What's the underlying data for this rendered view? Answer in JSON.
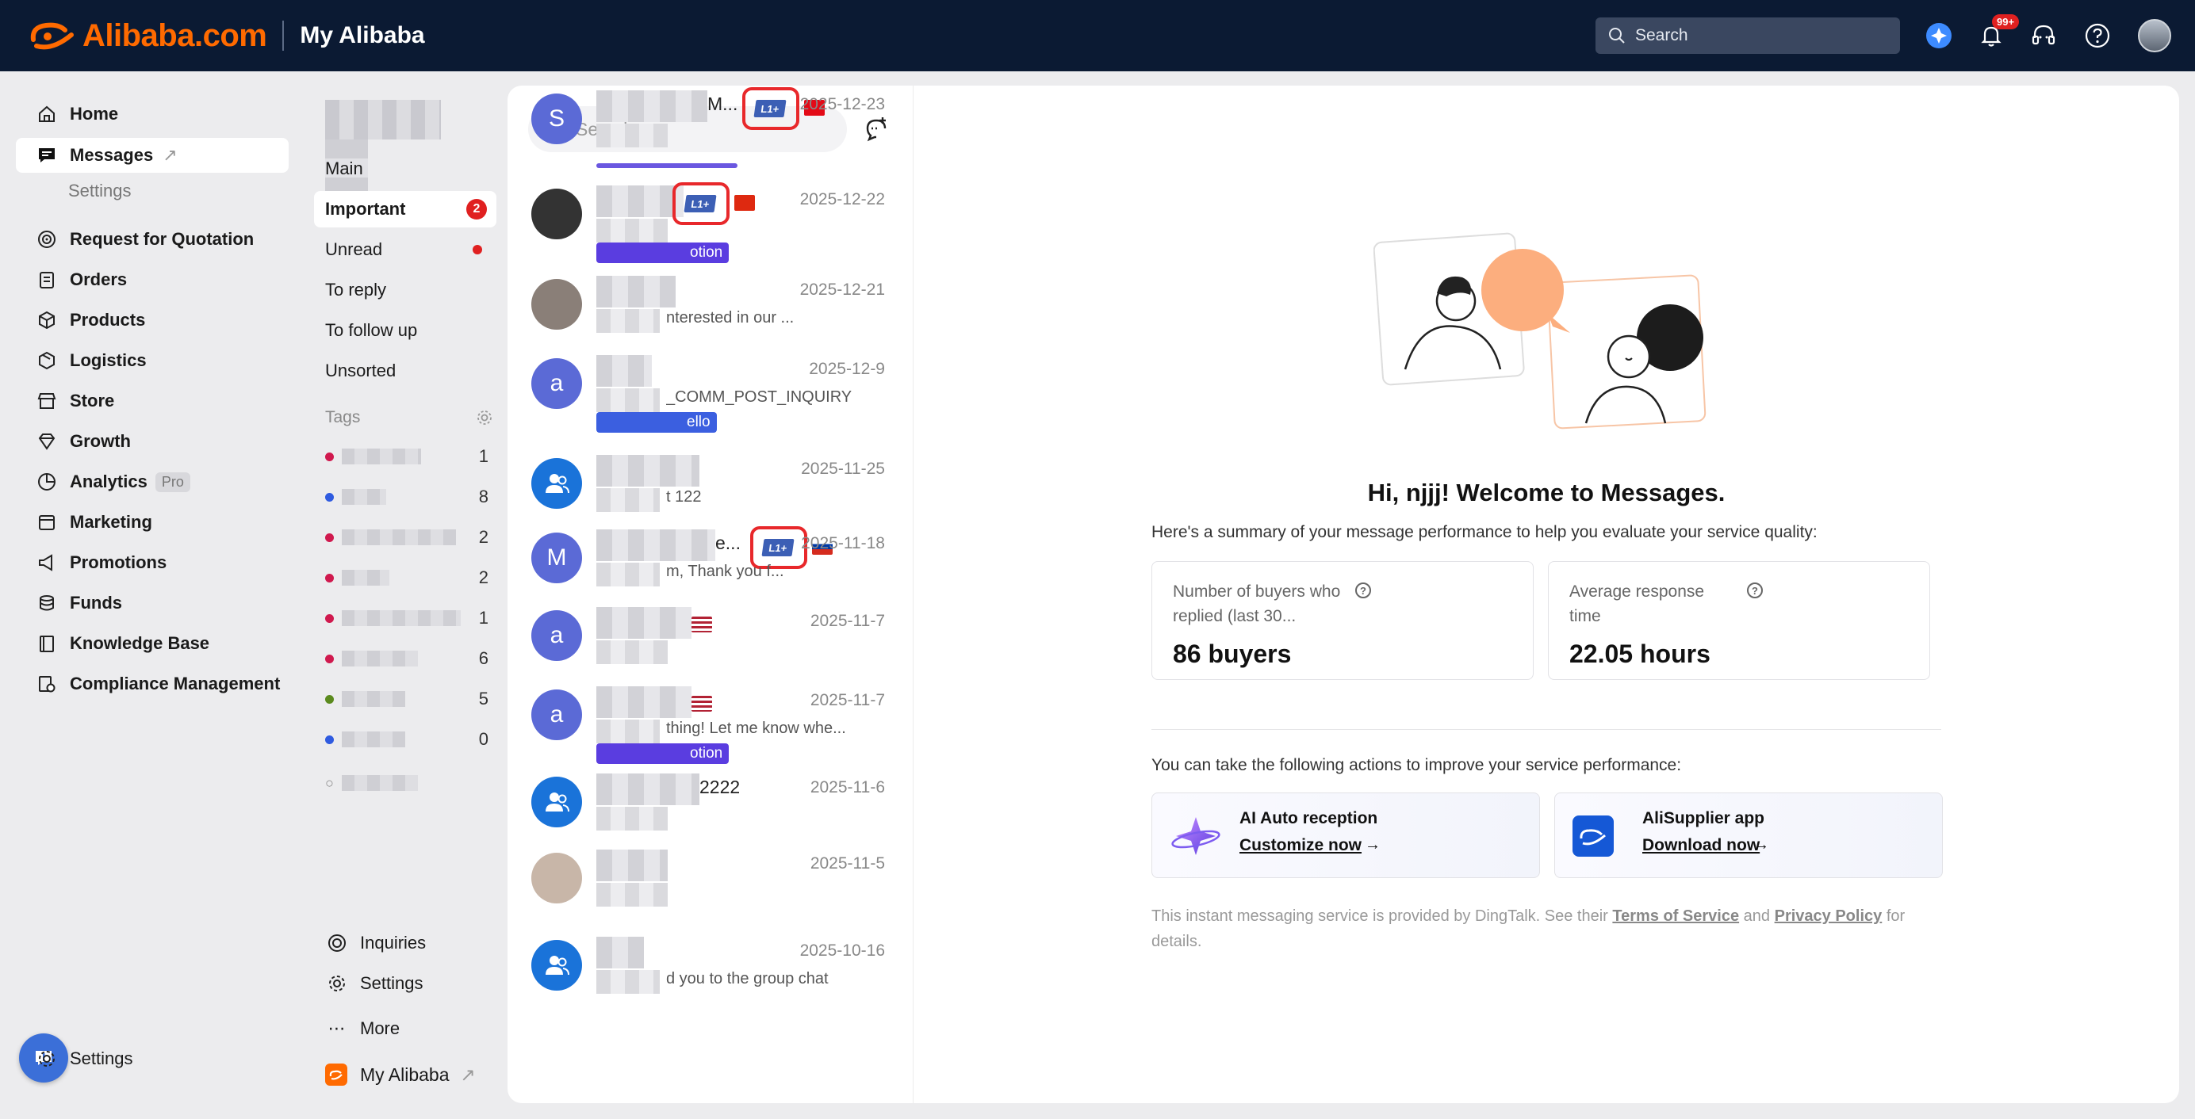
{
  "topbar": {
    "brand": "Alibaba.com",
    "section": "My Alibaba",
    "search_label": "Search",
    "notifications_badge": "99+"
  },
  "leftnav": {
    "items": [
      {
        "label": "Home",
        "icon": "home-icon"
      },
      {
        "label": "Messages",
        "icon": "message-icon"
      },
      {
        "label": "Request for Quotation",
        "icon": "target-icon"
      },
      {
        "label": "Orders",
        "icon": "clipboard-icon"
      },
      {
        "label": "Products",
        "icon": "box-icon"
      },
      {
        "label": "Logistics",
        "icon": "truck-icon"
      },
      {
        "label": "Store",
        "icon": "store-icon"
      },
      {
        "label": "Growth",
        "icon": "diamond-icon"
      },
      {
        "label": "Analytics",
        "icon": "chart-icon"
      },
      {
        "label": "Marketing",
        "icon": "calendar-icon"
      },
      {
        "label": "Promotions",
        "icon": "megaphone-icon"
      },
      {
        "label": "Funds",
        "icon": "coins-icon"
      },
      {
        "label": "Knowledge Base",
        "icon": "book-icon"
      },
      {
        "label": "Compliance Management",
        "icon": "shield-doc-icon"
      }
    ],
    "messages_sub": "Settings",
    "analytics_badge": "Pro",
    "bottom_settings": "Settings"
  },
  "folders": {
    "items": [
      "Main",
      "Important",
      "Unread",
      "To reply",
      "To follow up",
      "Unsorted"
    ],
    "important_count": "2",
    "tags_label": "Tags",
    "tags": [
      {
        "color": "#d0194e",
        "count": "1"
      },
      {
        "color": "#2f5be0",
        "count": "8"
      },
      {
        "color": "#d0194e",
        "count": "2"
      },
      {
        "color": "#d0194e",
        "count": "2"
      },
      {
        "color": "#d0194e",
        "count": "1"
      },
      {
        "color": "#d0194e",
        "count": "6"
      },
      {
        "color": "#5b8a1e",
        "count": "5"
      },
      {
        "color": "#2f5be0",
        "count": "0"
      }
    ],
    "inquiries": "Inquiries",
    "settings": "Settings",
    "more": "More",
    "my_alibaba": "My Alibaba"
  },
  "conversations": {
    "search_placeholder": "Search",
    "items": [
      {
        "avatar": "S",
        "avatar_color": "#5b6ad6",
        "name_tail": "M...",
        "badge": "L1+",
        "flag": "tr",
        "date": "2025-12-23",
        "preview": "",
        "tag": ""
      },
      {
        "avatar": "",
        "avatar_color": "#333",
        "name_tail": "",
        "badge": "L1+",
        "flag": "hk",
        "date": "2025-12-22",
        "preview": "",
        "tag": "otion"
      },
      {
        "avatar": "",
        "avatar_color": "#8a7f78",
        "name_tail": "",
        "badge": "",
        "flag": "",
        "date": "2025-12-21",
        "preview": "nterested in our ...",
        "tag": ""
      },
      {
        "avatar": "a",
        "avatar_color": "#5b6ad6",
        "name_tail": "",
        "badge": "",
        "flag": "",
        "date": "2025-12-9",
        "preview": "_COMM_POST_INQUIRY",
        "tag": "ello"
      },
      {
        "avatar": "",
        "avatar_color": "#1a73d9",
        "name_tail": "",
        "badge": "",
        "flag": "",
        "date": "2025-11-25",
        "preview": "t 122",
        "tag": ""
      },
      {
        "avatar": "M",
        "avatar_color": "#5b6ad6",
        "name_tail": "e...",
        "badge": "L1+",
        "flag": "ru",
        "date": "2025-11-18",
        "preview": "m, Thank you f...",
        "tag": ""
      },
      {
        "avatar": "a",
        "avatar_color": "#5b6ad6",
        "name_tail": "",
        "badge": "",
        "flag": "us",
        "date": "2025-11-7",
        "preview": "",
        "tag": ""
      },
      {
        "avatar": "a",
        "avatar_color": "#5b6ad6",
        "name_tail": "",
        "badge": "",
        "flag": "us",
        "date": "2025-11-7",
        "preview": "thing! Let me know whe...",
        "tag": "otion"
      },
      {
        "avatar": "",
        "avatar_color": "#1a73d9",
        "name_tail": "2222",
        "badge": "",
        "flag": "",
        "date": "2025-11-6",
        "preview": "",
        "tag": ""
      },
      {
        "avatar": "",
        "avatar_color": "#c8b6a8",
        "name_tail": "",
        "badge": "",
        "flag": "",
        "date": "2025-11-5",
        "preview": "",
        "tag": ""
      },
      {
        "avatar": "",
        "avatar_color": "#1a73d9",
        "name_tail": "",
        "badge": "",
        "flag": "",
        "date": "2025-10-16",
        "preview": "d you to the group chat",
        "tag": ""
      }
    ]
  },
  "welcome": {
    "title": "Hi, njjj! Welcome to Messages.",
    "summary": "Here's a summary of your message performance to help you evaluate your service quality:",
    "stat1_label": "Number of buyers who replied (last 30...",
    "stat1_value": "86 buyers",
    "stat2_label": "Average response time",
    "stat2_value": "22.05 hours",
    "actions_label": "You can take the following actions to improve your service performance:",
    "action1_title": "AI Auto reception",
    "action1_link": "Customize now",
    "action2_title": "AliSupplier app",
    "action2_link": "Download now",
    "arrow": "→",
    "foot_pre": "This instant messaging service is provided by DingTalk. See their",
    "foot_tos": "Terms of Service",
    "foot_and": "and",
    "foot_privacy": "Privacy Policy",
    "foot_post": "for details."
  }
}
